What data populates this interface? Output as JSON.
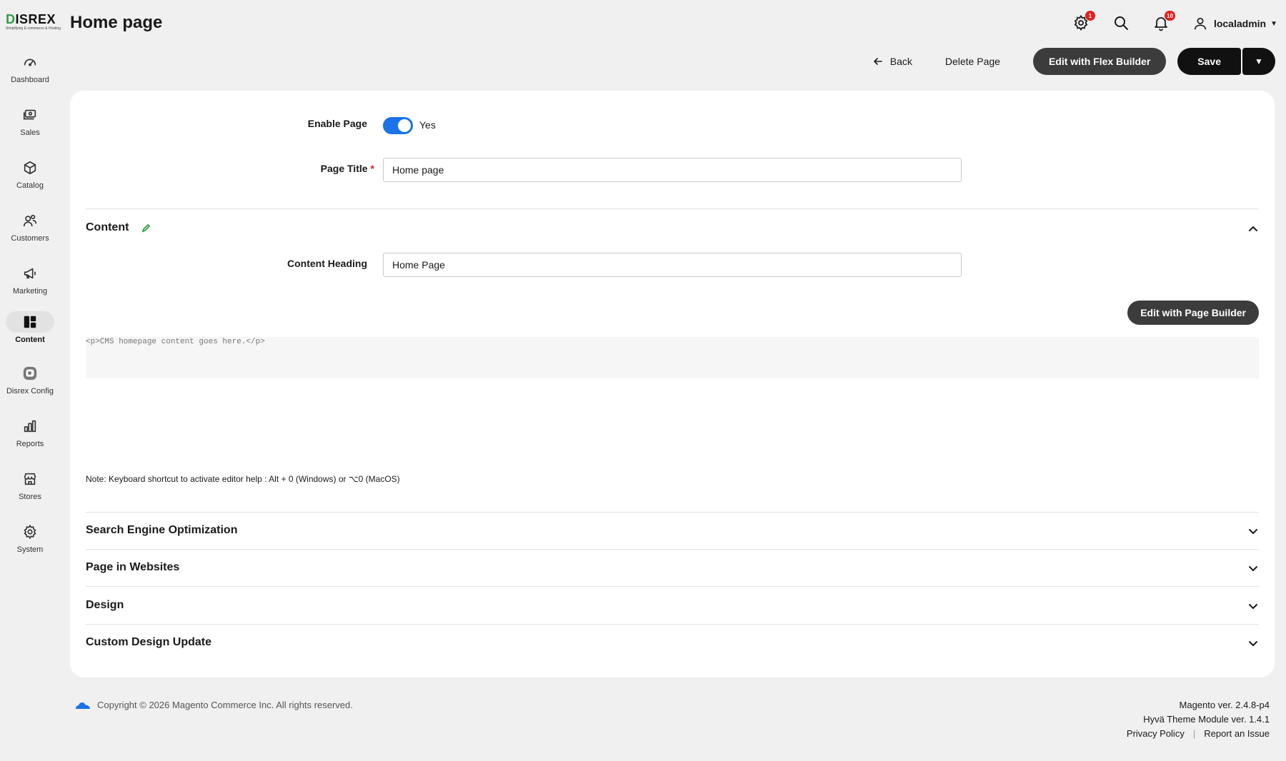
{
  "brand": {
    "logo_text": "ISREX",
    "logo_letter": "D",
    "logo_tagline": "Simplifying E-commerce & Hosting"
  },
  "header": {
    "title": "Home page",
    "user_name": "localadmin",
    "icons": [
      "system-messages-icon",
      "search-icon",
      "notifications-icon",
      "user-icon"
    ],
    "badges": {
      "system_messages": "1",
      "notifications": "10"
    }
  },
  "sidebar": {
    "items": [
      {
        "label": "Dashboard",
        "icon": "gauge-icon"
      },
      {
        "label": "Sales",
        "icon": "money-icon"
      },
      {
        "label": "Catalog",
        "icon": "box-icon"
      },
      {
        "label": "Customers",
        "icon": "users-icon"
      },
      {
        "label": "Marketing",
        "icon": "megaphone-icon"
      },
      {
        "label": "Content",
        "icon": "layout-icon",
        "active": true
      },
      {
        "label": "Disrex Config",
        "icon": "disrex-icon"
      },
      {
        "label": "Reports",
        "icon": "bar-chart-icon"
      },
      {
        "label": "Stores",
        "icon": "store-icon"
      },
      {
        "label": "System",
        "icon": "gear-icon"
      }
    ]
  },
  "actions": {
    "back": "Back",
    "delete": "Delete Page",
    "flex_builder": "Edit with Flex Builder",
    "save": "Save"
  },
  "form": {
    "enable_label": "Enable Page",
    "enable_value": "Yes",
    "title_label": "Page Title",
    "title_required": "*",
    "title_value": "Home page",
    "content_section": "Content",
    "content_heading_label": "Content Heading",
    "content_heading_value": "Home Page",
    "page_builder_button": "Edit with Page Builder",
    "editor_content": "<p>CMS homepage content goes here.</p>",
    "note": "Note: Keyboard shortcut to activate editor help : Alt + 0 (Windows) or ⌥0 (MacOS)"
  },
  "sections": [
    {
      "title": "Search Engine Optimization"
    },
    {
      "title": "Page in Websites"
    },
    {
      "title": "Design"
    },
    {
      "title": "Custom Design Update"
    }
  ],
  "footer": {
    "copyright": "Copyright © 2026 Magento Commerce Inc. All rights reserved.",
    "magento_version": "Magento ver. 2.4.8-p4",
    "hyva_version": "Hyvä Theme Module ver. 1.4.1",
    "privacy": "Privacy Policy",
    "separator": "|",
    "report": "Report an Issue"
  },
  "colors": {
    "toggle_on": "#1a73e8",
    "required": "#e02020",
    "dark_button": "#111111",
    "edit_pencil": "#2f9e44"
  }
}
